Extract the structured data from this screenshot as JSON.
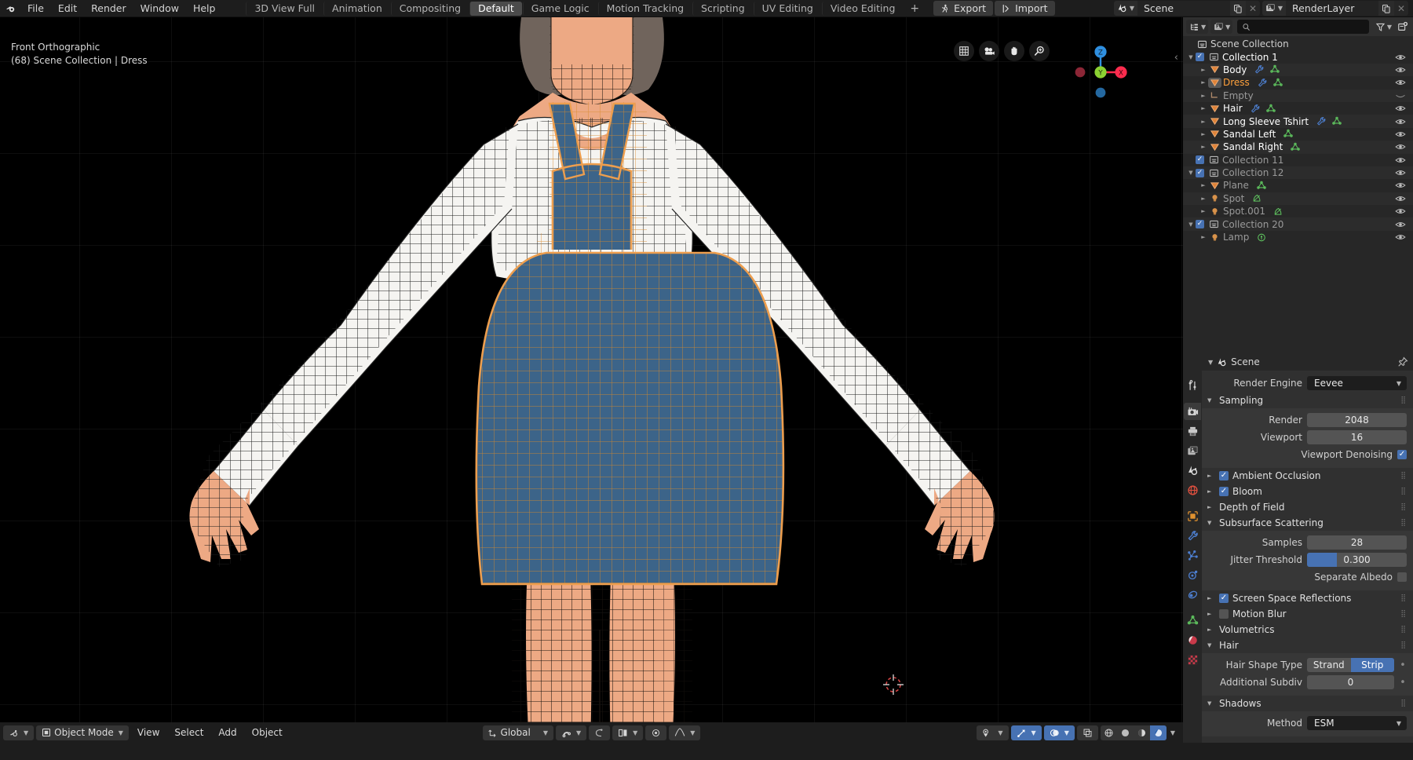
{
  "topbar": {
    "logo_icon": "blender-logo-icon",
    "menus": [
      "File",
      "Edit",
      "Render",
      "Window",
      "Help"
    ],
    "workspaces": [
      {
        "label": "3D View Full",
        "active": false
      },
      {
        "label": "Animation",
        "active": false
      },
      {
        "label": "Compositing",
        "active": false
      },
      {
        "label": "Default",
        "active": true
      },
      {
        "label": "Game Logic",
        "active": false
      },
      {
        "label": "Motion Tracking",
        "active": false
      },
      {
        "label": "Scripting",
        "active": false
      },
      {
        "label": "UV Editing",
        "active": false
      },
      {
        "label": "Video Editing",
        "active": false
      }
    ],
    "add_workspace_label": "+",
    "export_label": "Export",
    "import_label": "Import",
    "scene_name": "Scene",
    "view_layer_name": "RenderLayer"
  },
  "viewport": {
    "view_name": "Front Orthographic",
    "scene_info": "(68) Scene Collection | Dress",
    "gizmo_buttons": [
      "grid-icon",
      "camera-icon",
      "hand-icon",
      "zoom-icon"
    ],
    "axis_labels": {
      "z": "Z",
      "y": "Y",
      "x": "X"
    },
    "colors": {
      "axis_x": "#fc2c4e",
      "axis_y": "#8bd132",
      "axis_z": "#2f8fe0",
      "selected_outline": "#ed9e4e",
      "skin": "#f0a883",
      "dress": "#3a6185",
      "shirt": "#f3f2ef",
      "hair": "#6d6059"
    }
  },
  "viewport_footer": {
    "editor_type_icon": "editor-type-3dview-icon",
    "mode": "Object Mode",
    "menus": [
      "View",
      "Select",
      "Add",
      "Object"
    ],
    "transform_orientation": "Global",
    "snap_icon": "magnet-icon",
    "proportional_icon": "proportional-edit-icon",
    "pivot_icon": "pivot-point-icon",
    "overlays_icon": "overlays-icon",
    "xray_icon": "xray-icon",
    "shading_modes": [
      "wireframe-icon",
      "solid-icon",
      "material-preview-icon",
      "rendered-icon"
    ],
    "active_shading": "rendered-icon",
    "visibility_icon": "object-visibility-icon",
    "gizmo_icon": "gizmo-icon",
    "overlay_icon": "show-overlays-icon"
  },
  "outliner": {
    "display_mode_icon": "outliner-display-mode-icon",
    "view_layer_icon": "view-layer-icon",
    "search_placeholder": "",
    "search_value": "",
    "filter_icon": "filter-icon",
    "new_collection_icon": "new-collection-icon",
    "root": "Scene Collection",
    "rows": [
      {
        "label": "Collection 1",
        "type": "collection",
        "indent": 0,
        "expanded": true,
        "checkbox": true,
        "eye": true,
        "state": "normal"
      },
      {
        "label": "Body",
        "type": "mesh",
        "indent": 1,
        "expanded": false,
        "checkbox": null,
        "eye": true,
        "state": "normal",
        "extras": [
          "modifier-icon",
          "mesh-data-icon"
        ]
      },
      {
        "label": "Dress",
        "type": "mesh",
        "indent": 1,
        "expanded": false,
        "checkbox": null,
        "eye": true,
        "state": "selected",
        "extras": [
          "modifier-icon",
          "mesh-data-icon"
        ]
      },
      {
        "label": "Empty",
        "type": "empty",
        "indent": 1,
        "expanded": false,
        "checkbox": null,
        "eye": false,
        "state": "dim",
        "extras": []
      },
      {
        "label": "Hair",
        "type": "mesh",
        "indent": 1,
        "expanded": false,
        "checkbox": null,
        "eye": true,
        "state": "normal",
        "extras": [
          "modifier-icon",
          "mesh-data-icon"
        ]
      },
      {
        "label": "Long Sleeve Tshirt",
        "type": "mesh",
        "indent": 1,
        "expanded": false,
        "checkbox": null,
        "eye": true,
        "state": "normal",
        "extras": [
          "modifier-icon",
          "mesh-data-icon"
        ]
      },
      {
        "label": "Sandal Left",
        "type": "mesh",
        "indent": 1,
        "expanded": false,
        "checkbox": null,
        "eye": true,
        "state": "normal",
        "extras": [
          "mesh-data-icon"
        ]
      },
      {
        "label": "Sandal Right",
        "type": "mesh",
        "indent": 1,
        "expanded": false,
        "checkbox": null,
        "eye": true,
        "state": "normal",
        "extras": [
          "mesh-data-icon"
        ]
      },
      {
        "label": "Collection 11",
        "type": "collection",
        "indent": 0,
        "expanded": null,
        "checkbox": true,
        "eye": true,
        "state": "dim"
      },
      {
        "label": "Collection 12",
        "type": "collection",
        "indent": 0,
        "expanded": true,
        "checkbox": true,
        "eye": true,
        "state": "dim"
      },
      {
        "label": "Plane",
        "type": "mesh",
        "indent": 1,
        "expanded": false,
        "checkbox": null,
        "eye": true,
        "state": "dim",
        "extras": [
          "mesh-data-icon"
        ]
      },
      {
        "label": "Spot",
        "type": "light",
        "indent": 1,
        "expanded": false,
        "checkbox": null,
        "eye": true,
        "state": "dim",
        "extras": [
          "light-data-icon"
        ]
      },
      {
        "label": "Spot.001",
        "type": "light",
        "indent": 1,
        "expanded": false,
        "checkbox": null,
        "eye": true,
        "state": "dim",
        "extras": [
          "light-data-icon"
        ]
      },
      {
        "label": "Collection 20",
        "type": "collection",
        "indent": 0,
        "expanded": true,
        "checkbox": true,
        "eye": true,
        "state": "dim"
      },
      {
        "label": "Lamp",
        "type": "light",
        "indent": 1,
        "expanded": false,
        "checkbox": null,
        "eye": true,
        "state": "dim",
        "extras": [
          "point-light-data-icon"
        ]
      }
    ]
  },
  "properties": {
    "tabs": [
      {
        "name": "tool",
        "icon": "tool-icon",
        "active": false
      },
      {
        "name": "render",
        "icon": "render-camera-icon",
        "active": true
      },
      {
        "name": "output",
        "icon": "printer-icon",
        "active": false
      },
      {
        "name": "view-layer",
        "icon": "images-icon",
        "active": false
      },
      {
        "name": "scene",
        "icon": "scene-cone-icon",
        "active": false
      },
      {
        "name": "world",
        "icon": "world-globe-icon",
        "active": false
      },
      {
        "name": "object",
        "icon": "object-square-icon",
        "active": false
      },
      {
        "name": "modifiers",
        "icon": "wrench-icon",
        "active": false
      },
      {
        "name": "particles",
        "icon": "particles-icon",
        "active": false
      },
      {
        "name": "physics",
        "icon": "physics-orbit-icon",
        "active": false
      },
      {
        "name": "constraints",
        "icon": "constraints-icon",
        "active": false
      },
      {
        "name": "object-data",
        "icon": "mesh-data-icon",
        "active": false
      },
      {
        "name": "material",
        "icon": "material-sphere-icon",
        "active": false
      },
      {
        "name": "texture",
        "icon": "texture-checker-icon",
        "active": false
      }
    ],
    "breadcrumb_icon": "scene-cone-icon",
    "breadcrumb": "Scene",
    "pin_icon": "pin-icon",
    "render_engine_label": "Render Engine",
    "render_engine_value": "Eevee",
    "sections": {
      "sampling": {
        "title": "Sampling",
        "expanded": true,
        "render_label": "Render",
        "render_value": "2048",
        "viewport_label": "Viewport",
        "viewport_value": "16",
        "denoise_label": "Viewport Denoising",
        "denoise_checked": true
      },
      "ambient_occlusion": {
        "title": "Ambient Occlusion",
        "expanded": false,
        "checked": true
      },
      "bloom": {
        "title": "Bloom",
        "expanded": false,
        "checked": true
      },
      "depth_of_field": {
        "title": "Depth of Field",
        "expanded": false,
        "checked": null
      },
      "subsurface_scattering": {
        "title": "Subsurface Scattering",
        "expanded": true,
        "samples_label": "Samples",
        "samples_value": "28",
        "jitter_label": "Jitter Threshold",
        "jitter_value": "0.300",
        "jitter_fraction": 0.3,
        "separate_albedo_label": "Separate Albedo",
        "separate_albedo_checked": false
      },
      "screen_space_reflections": {
        "title": "Screen Space Reflections",
        "expanded": false,
        "checked": true
      },
      "motion_blur": {
        "title": "Motion Blur",
        "expanded": false,
        "checked": false
      },
      "volumetrics": {
        "title": "Volumetrics",
        "expanded": false,
        "checked": null
      },
      "hair": {
        "title": "Hair",
        "expanded": true,
        "shape_type_label": "Hair Shape Type",
        "shape_options": [
          "Strand",
          "Strip"
        ],
        "shape_active": "Strip",
        "subdiv_label": "Additional Subdiv",
        "subdiv_value": "0"
      },
      "shadows": {
        "title": "Shadows",
        "expanded": true,
        "method_label": "Method",
        "method_value": "ESM"
      }
    }
  }
}
